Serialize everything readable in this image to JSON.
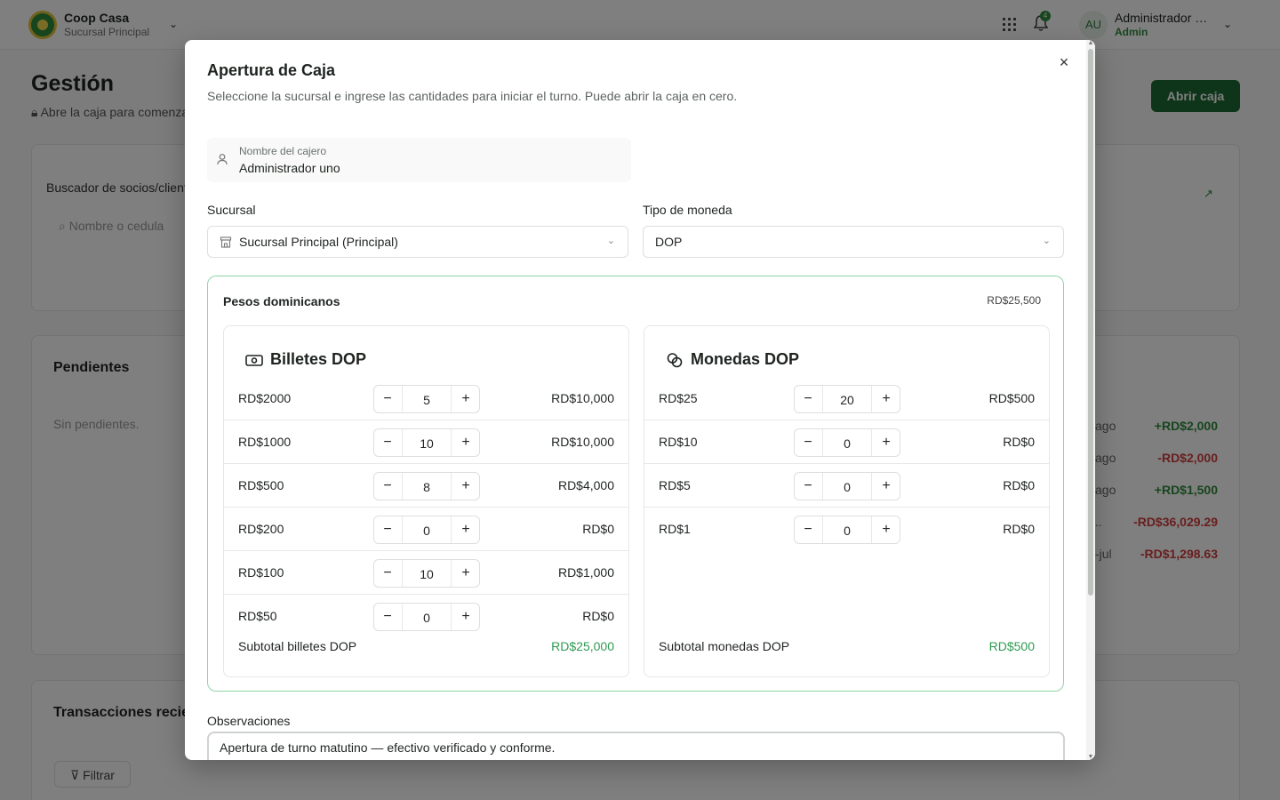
{
  "header": {
    "org_name": "Coop Casa",
    "org_branch": "Sucursal Principal",
    "notification_count": "4",
    "user_initials": "AU",
    "user_name": "Administrador uno",
    "user_role": "Admin"
  },
  "page": {
    "title": "Gestión",
    "subtitle": "Abre la caja para comenzar",
    "open_button": "Abrir caja",
    "search_label": "Buscador de socios/clientes",
    "search_placeholder": "Nombre o cedula",
    "pending_title": "Pendientes",
    "pending_empty": "Sin pendientes.",
    "transactions_title": "Transacciones recientes",
    "filter_button": "Filtrar",
    "transactions": [
      {
        "date": "ago",
        "amount": "+RD$2,000",
        "sign": "pos"
      },
      {
        "date": "ago",
        "amount": "-RD$2,000",
        "sign": "neg"
      },
      {
        "date": "ago",
        "amount": "+RD$1,500",
        "sign": "pos"
      },
      {
        "date": "..",
        "amount": "-RD$36,029.29",
        "sign": "neg"
      },
      {
        "date": "-jul",
        "amount": "-RD$1,298.63",
        "sign": "neg"
      }
    ]
  },
  "modal": {
    "title": "Apertura de Caja",
    "description": "Seleccione la sucursal e ingrese las cantidades para iniciar el turno. Puede abrir la caja en cero.",
    "cashier_label": "Nombre del cajero",
    "cashier_value": "Administrador uno",
    "branch_label": "Sucursal",
    "branch_value": "Sucursal Principal (Principal)",
    "currency_label": "Tipo de moneda",
    "currency_value": "DOP",
    "currency_name": "Pesos dominicanos",
    "currency_total": "RD$25,500",
    "bills": {
      "title": "Billetes DOP",
      "rows": [
        {
          "den": "RD$2000",
          "qty": "5",
          "amount": "RD$10,000"
        },
        {
          "den": "RD$1000",
          "qty": "10",
          "amount": "RD$10,000"
        },
        {
          "den": "RD$500",
          "qty": "8",
          "amount": "RD$4,000"
        },
        {
          "den": "RD$200",
          "qty": "0",
          "amount": "RD$0"
        },
        {
          "den": "RD$100",
          "qty": "10",
          "amount": "RD$1,000"
        },
        {
          "den": "RD$50",
          "qty": "0",
          "amount": "RD$0"
        }
      ],
      "subtotal_label": "Subtotal billetes DOP",
      "subtotal_value": "RD$25,000"
    },
    "coins": {
      "title": "Monedas DOP",
      "rows": [
        {
          "den": "RD$25",
          "qty": "20",
          "amount": "RD$500"
        },
        {
          "den": "RD$10",
          "qty": "0",
          "amount": "RD$0"
        },
        {
          "den": "RD$5",
          "qty": "0",
          "amount": "RD$0"
        },
        {
          "den": "RD$1",
          "qty": "0",
          "amount": "RD$0"
        }
      ],
      "subtotal_label": "Subtotal monedas DOP",
      "subtotal_value": "RD$500"
    },
    "observations_label": "Observaciones",
    "observations_value": "Apertura de turno matutino — efectivo verificado y conforme.",
    "stepper_minus": "−",
    "stepper_plus": "+",
    "close_glyph": "×"
  },
  "icons": {
    "close": "close-icon",
    "user": "user-icon",
    "branch": "store-icon",
    "bills": "banknote-icon",
    "coins": "coins-icon",
    "search": "search-icon",
    "bell": "bell-icon",
    "grid": "grid-icon",
    "filter": "filter-icon",
    "trend": "trend-up-icon",
    "lock": "lock-icon"
  },
  "colors": {
    "brand": "#1d6b34",
    "accent_border": "#8fd5a8",
    "positive": "#2f9a52",
    "negative": "#d23c3c"
  }
}
